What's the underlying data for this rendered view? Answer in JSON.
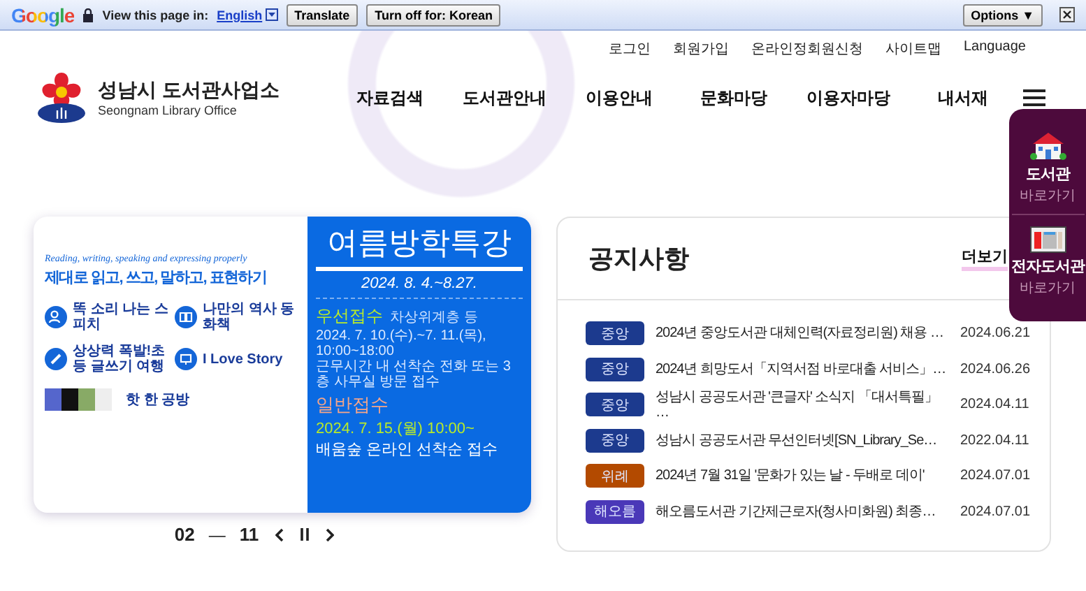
{
  "translate_bar": {
    "logo": "Google",
    "prompt": "View this page in:",
    "language": "English",
    "buttons": [
      "Translate",
      "Turn off for: Korean"
    ],
    "options": "Options ▼"
  },
  "utility_links": [
    "로그인",
    "회원가입",
    "온라인정회원신청",
    "사이트맵",
    "Language"
  ],
  "logo": {
    "title": "성남시 도서관사업소",
    "subtitle": "Seongnam Library Office"
  },
  "nav": [
    "자료검색",
    "도서관안내",
    "이용안내",
    "문화마당",
    "이용자마당",
    "내서재"
  ],
  "quick_menu": [
    {
      "kind": "library",
      "title": "도서관",
      "subtitle": "바로가기"
    },
    {
      "kind": "ebook",
      "title": "전자도서관",
      "subtitle": "바로가기"
    }
  ],
  "banner": {
    "tagline": "Reading, writing, speaking and expressing properly",
    "heading": "제대로  읽고, 쓰고, 말하고, 표현하기",
    "programs": [
      {
        "kind": "speech",
        "label": "똑 소리 나는 스피치"
      },
      {
        "kind": "book",
        "label": "나만의 역사 동화책"
      },
      {
        "kind": "pencil",
        "label": "상상력 폭발!초등 글쓰기 여행"
      },
      {
        "kind": "screen",
        "label": "I Love Story"
      }
    ],
    "workshop": "핫 한 공방",
    "title": "여름방학특강",
    "period": "2024. 8. 4.~8.27.",
    "priority": {
      "label": "우선접수",
      "note": "차상위계층 등",
      "lines": [
        "2024. 7. 10.(수).~7. 11.(목), 10:00~18:00",
        "근무시간 내 선착순 전화  또는 3층 사무실 방문 접수"
      ]
    },
    "general": {
      "label": "일반접수",
      "date": "2024. 7. 15.(월) 10:00~",
      "method": "배움숲 온라인 선착순 접수"
    }
  },
  "pager": {
    "current": "02",
    "separator": "—",
    "total": "11"
  },
  "notices": {
    "title": "공지사항",
    "more": "더보기",
    "items": [
      {
        "category": "중앙",
        "color": "#1c3a8e",
        "title": "2024년 중앙도서관 대체인력(자료정리원) 채용 …",
        "date": "2024.06.21"
      },
      {
        "category": "중앙",
        "color": "#1c3a8e",
        "title": "2024년 희망도서「지역서점 바로대출 서비스」…",
        "date": "2024.06.26"
      },
      {
        "category": "중앙",
        "color": "#1c3a8e",
        "title": "성남시 공공도서관 '큰글자' 소식지 「대서특필」 …",
        "date": "2024.04.11"
      },
      {
        "category": "중앙",
        "color": "#1c3a8e",
        "title": "성남시 공공도서관 무선인터넷[SN_Library_Se…",
        "date": "2022.04.11"
      },
      {
        "category": "위례",
        "color": "#b34a00",
        "title": "2024년 7월 31일 '문화가 있는 날 - 두배로 데이'",
        "date": "2024.07.01"
      },
      {
        "category": "해오름",
        "color": "#4a38b8",
        "title": "해오름도서관 기간제근로자(청사미화원) 최종…",
        "date": "2024.07.01"
      }
    ]
  }
}
